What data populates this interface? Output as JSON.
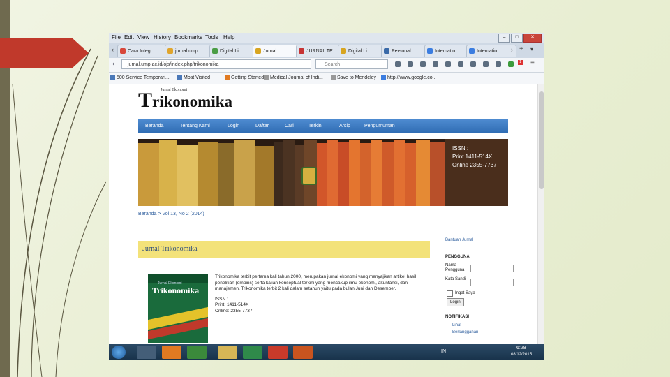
{
  "browser": {
    "menu": [
      "File",
      "Edit",
      "View",
      "History",
      "Bookmarks",
      "Tools",
      "Help"
    ],
    "window_controls": [
      "–",
      "□",
      "✕"
    ],
    "tabs": [
      {
        "label": "Cara Integ...",
        "icon_color": "#d8473a"
      },
      {
        "label": "jurnal.ump...",
        "icon_color": "#e0a52c"
      },
      {
        "label": "Digital Li...",
        "icon_color": "#4a9d45"
      },
      {
        "label": "Jurnal...",
        "icon_color": "#d8a520",
        "active": true
      },
      {
        "label": "JURNAL TE...",
        "icon_color": "#c73434"
      },
      {
        "label": "Digital Li...",
        "icon_color": "#d8a520"
      },
      {
        "label": "Personal...",
        "icon_color": "#3a6aa8"
      },
      {
        "label": "Internatio...",
        "icon_color": "#3b7de0"
      },
      {
        "label": "Internatio...",
        "icon_color": "#3b7de0"
      }
    ],
    "url": "jurnal.ump.ac.id/ojs/index.php/trikonomika",
    "search_placeholder": "Search",
    "bookmarks": [
      "500 Service Temporari...",
      "Most Visited",
      "Getting Started",
      "Medical Journal of Indi...",
      "Save to Mendeley",
      "http://www.google.co..."
    ],
    "notification_count": "1"
  },
  "site": {
    "logo_small": "Jurnal Ekonomi",
    "logo_initial": "T",
    "logo_rest": "rikonomika",
    "nav": [
      "Beranda",
      "Tentang Kami",
      "Login",
      "Daftar",
      "Cari",
      "Terkini",
      "Arsip",
      "Pengumuman"
    ],
    "banner": {
      "issn_label": "ISSN :",
      "print": "Print 1411-514X",
      "online": "Online 2355-7737"
    },
    "breadcrumb": "Beranda > Vol 13, No 2 (2014)",
    "journal_title": "Jurnal Trikonomika",
    "cover": {
      "small": "Jurnal Ekonomi",
      "title": "Trikonomika"
    },
    "description": "Trikonomika terbit pertama kali tahun 2000, merupakan jurnal ekonomi yang menyajikan artikel hasil penelitian (empiris) serta kajian konseptual terkini yang mencakup ilmu ekonomi, akuntansi, dan manajemen. Trikonomika terbit 2 kali dalam setahun yaitu pada bulan Juni dan Desember.",
    "issn_label": "ISSN :",
    "issn_print": "Print: 1411-514X",
    "issn_online": "Online: 2355-7737",
    "sidebar": {
      "help_link": "Bantuan Jurnal",
      "user_heading": "PENGGUNA",
      "username_label": "Nama Pengguna",
      "password_label": "Kata Sandi",
      "remember_label": "Ingat Saya",
      "login_button": "Login",
      "notif_heading": "NOTIFIKASI",
      "notif_items": [
        "Lihat",
        "Berlangganan"
      ]
    }
  },
  "taskbar": {
    "lang": "IN",
    "time": "6:28",
    "date": "08/12/2015"
  },
  "colors": {
    "slide_arrow": "#c0392b",
    "site_nav": "#3a78c0",
    "journal_header": "#f3e27a"
  }
}
